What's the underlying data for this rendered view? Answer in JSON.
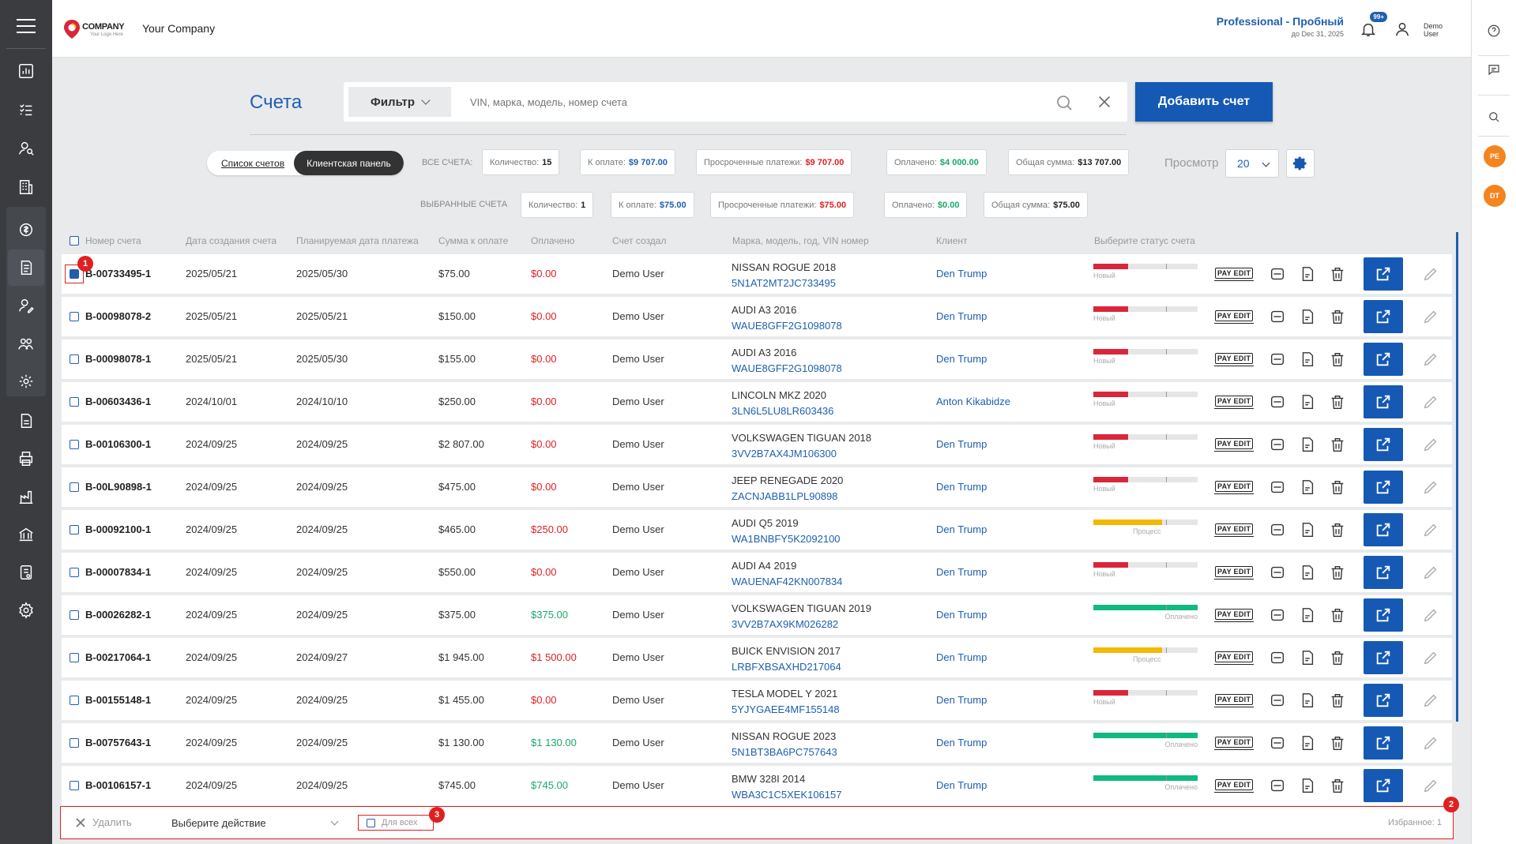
{
  "header": {
    "brand": "COMPANY",
    "brand_tagline": "Your Logo Here",
    "company_name": "Your Company",
    "plan_name": "Professional - Пробный",
    "plan_until": "до Dec 31, 2025",
    "notifications_badge": "99+",
    "user_name": "Demo User"
  },
  "page": {
    "title": "Счета",
    "filter_label": "Фильтр",
    "search_placeholder": "VIN, марка, модель, номер счета",
    "add_button": "Добавить счет"
  },
  "view_toggle": {
    "list": "Список счетов",
    "panel": "Клиентская панель"
  },
  "stats_all": {
    "label": "ВСЕ СЧЕТА:",
    "count_label": "Количество:",
    "count": "15",
    "due_label": "К оплате:",
    "due": "$9 707.00",
    "overdue_label": "Просроченные платежи:",
    "overdue": "$9 707.00",
    "paid_label": "Оплачено:",
    "paid": "$4 000.00",
    "total_label": "Общая сумма:",
    "total": "$13 707.00"
  },
  "stats_selected": {
    "label": "ВЫБРАННЫЕ СЧЕТА",
    "count_label": "Количество:",
    "count": "1",
    "due_label": "К оплате:",
    "due": "$75.00",
    "overdue_label": "Просроченные платежи:",
    "overdue": "$75.00",
    "paid_label": "Оплачено:",
    "paid": "$0.00",
    "total_label": "Общая сумма:",
    "total": "$75.00"
  },
  "view": {
    "label": "Просмотр",
    "per_page": "20"
  },
  "table": {
    "headers": [
      "Номер счета",
      "Дата создания счета",
      "Планируемая дата платежа",
      "Сумма к оплате",
      "Оплачено",
      "Счет создал",
      "Марка, модель, год, VIN номер",
      "Клиент",
      "Выберите статус счета"
    ],
    "action_labels": {
      "pay_edit": "PAY EDIT"
    },
    "rows": [
      {
        "number": "B-00733495-1",
        "created": "2025/05/21",
        "planned": "2025/05/30",
        "amount": "$75.00",
        "paid": "$0.00",
        "paid_color": "red",
        "creator": "Demo User",
        "car": "NISSAN ROGUE 2018",
        "vin": "5N1AT2MT2JC733495",
        "client": "Den Trump",
        "status": "Новый",
        "status_fill": 0.33,
        "status_color": "#d9263a",
        "checked": true
      },
      {
        "number": "B-00098078-2",
        "created": "2025/05/21",
        "planned": "2025/05/21",
        "amount": "$150.00",
        "paid": "$0.00",
        "paid_color": "red",
        "creator": "Demo User",
        "car": "AUDI A3 2016",
        "vin": "WAUE8GFF2G1098078",
        "client": "Den Trump",
        "status": "Новый",
        "status_fill": 0.33,
        "status_color": "#d9263a",
        "checked": false
      },
      {
        "number": "B-00098078-1",
        "created": "2025/05/21",
        "planned": "2025/05/30",
        "amount": "$155.00",
        "paid": "$0.00",
        "paid_color": "red",
        "creator": "Demo User",
        "car": "AUDI A3 2016",
        "vin": "WAUE8GFF2G1098078",
        "client": "Den Trump",
        "status": "Новый",
        "status_fill": 0.33,
        "status_color": "#d9263a",
        "checked": false
      },
      {
        "number": "B-00603436-1",
        "created": "2024/10/01",
        "planned": "2024/10/10",
        "amount": "$250.00",
        "paid": "$0.00",
        "paid_color": "red",
        "creator": "Demo User",
        "car": "LINCOLN MKZ 2020",
        "vin": "3LN6L5LU8LR603436",
        "client": "Anton Kikabidze",
        "status": "Новый",
        "status_fill": 0.33,
        "status_color": "#d9263a",
        "checked": false
      },
      {
        "number": "B-00106300-1",
        "created": "2024/09/25",
        "planned": "2024/09/25",
        "amount": "$2 807.00",
        "paid": "$0.00",
        "paid_color": "red",
        "creator": "Demo User",
        "car": "VOLKSWAGEN TIGUAN 2018",
        "vin": "3VV2B7AX4JM106300",
        "client": "Den Trump",
        "status": "Новый",
        "status_fill": 0.33,
        "status_color": "#d9263a",
        "checked": false
      },
      {
        "number": "B-00L90898-1",
        "created": "2024/09/25",
        "planned": "2024/09/25",
        "amount": "$475.00",
        "paid": "$0.00",
        "paid_color": "red",
        "creator": "Demo User",
        "car": "JEEP RENEGADE 2020",
        "vin": "ZACNJABB1LPL90898",
        "client": "Den Trump",
        "status": "Новый",
        "status_fill": 0.33,
        "status_color": "#d9263a",
        "checked": false
      },
      {
        "number": "B-00092100-1",
        "created": "2024/09/25",
        "planned": "2024/09/25",
        "amount": "$465.00",
        "paid": "$250.00",
        "paid_color": "red",
        "creator": "Demo User",
        "car": "AUDI Q5 2019",
        "vin": "WA1BNBFY5K2092100",
        "client": "Den Trump",
        "status": "Процесс",
        "status_fill": 0.66,
        "status_color": "#f5b800",
        "checked": false
      },
      {
        "number": "B-00007834-1",
        "created": "2024/09/25",
        "planned": "2024/09/25",
        "amount": "$550.00",
        "paid": "$0.00",
        "paid_color": "red",
        "creator": "Demo User",
        "car": "AUDI A4 2019",
        "vin": "WAUENAF42KN007834",
        "client": "Den Trump",
        "status": "Новый",
        "status_fill": 0.33,
        "status_color": "#d9263a",
        "checked": false
      },
      {
        "number": "B-00026282-1",
        "created": "2024/09/25",
        "planned": "2024/09/25",
        "amount": "$375.00",
        "paid": "$375.00",
        "paid_color": "green",
        "creator": "Demo User",
        "car": "VOLKSWAGEN TIGUAN 2019",
        "vin": "3VV2B7AX9KM026282",
        "client": "Den Trump",
        "status": "Оплачено",
        "status_fill": 1.0,
        "status_color": "#10b981",
        "checked": false
      },
      {
        "number": "B-00217064-1",
        "created": "2024/09/25",
        "planned": "2024/09/27",
        "amount": "$1 945.00",
        "paid": "$1 500.00",
        "paid_color": "red",
        "creator": "Demo User",
        "car": "BUICK ENVISION 2017",
        "vin": "LRBFXBSAXHD217064",
        "client": "Den Trump",
        "status": "Процесс",
        "status_fill": 0.66,
        "status_color": "#f5b800",
        "checked": false
      },
      {
        "number": "B-00155148-1",
        "created": "2024/09/25",
        "planned": "2024/09/25",
        "amount": "$1 455.00",
        "paid": "$0.00",
        "paid_color": "red",
        "creator": "Demo User",
        "car": "TESLA MODEL Y 2021",
        "vin": "5YJYGAEE4MF155148",
        "client": "Den Trump",
        "status": "Новый",
        "status_fill": 0.33,
        "status_color": "#d9263a",
        "checked": false
      },
      {
        "number": "B-00757643-1",
        "created": "2024/09/25",
        "planned": "2024/09/25",
        "amount": "$1 130.00",
        "paid": "$1 130.00",
        "paid_color": "green",
        "creator": "Demo User",
        "car": "NISSAN ROGUE 2023",
        "vin": "5N1BT3BA6PC757643",
        "client": "Den Trump",
        "status": "Оплачено",
        "status_fill": 1.0,
        "status_color": "#10b981",
        "checked": false
      },
      {
        "number": "B-00106157-1",
        "created": "2024/09/25",
        "planned": "2024/09/25",
        "amount": "$745.00",
        "paid": "$745.00",
        "paid_color": "green",
        "creator": "Demo User",
        "car": "BMW 328I 2014",
        "vin": "WBA3C1C5XEK106157",
        "client": "Den Trump",
        "status": "Оплачено",
        "status_fill": 1.0,
        "status_color": "#10b981",
        "checked": false
      }
    ]
  },
  "bottom_bar": {
    "delete_label": "Удалить",
    "action_placeholder": "Выберите действие",
    "for_all_label": "Для всех",
    "favorites_label": "Избранное: 1"
  },
  "annotations": [
    "1",
    "2",
    "3"
  ],
  "right_rail": {
    "avatar_1": "PE",
    "avatar_2": "DT"
  },
  "colors": {
    "primary": "#1559b4",
    "accent_orange": "#f5841f",
    "danger": "#e02020",
    "success": "#1aa86a"
  }
}
